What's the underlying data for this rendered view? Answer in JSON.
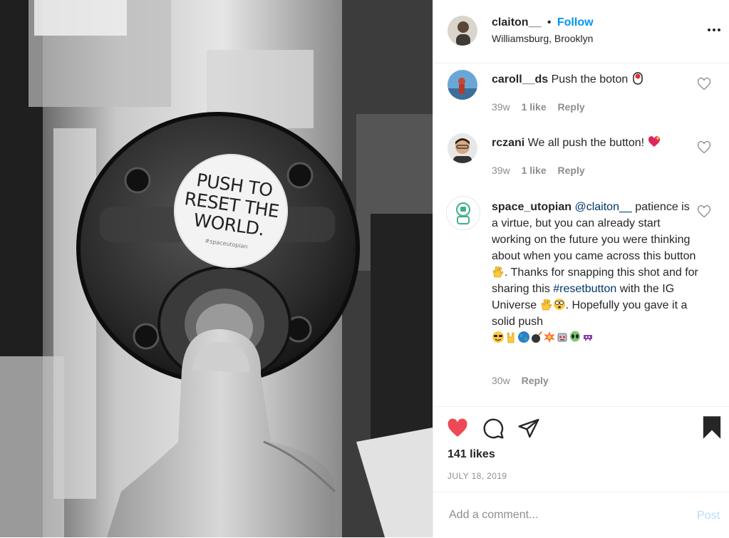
{
  "photo": {
    "sticker_lines": [
      "PUSH TO",
      "RESET THE",
      "WORLD."
    ],
    "sticker_tag": "#spaceutopian"
  },
  "header": {
    "username": "claiton__",
    "separator": "•",
    "follow_label": "Follow",
    "location": "Williamsburg, Brooklyn",
    "more_icon": "more-horizontal-icon"
  },
  "comments": [
    {
      "username": "caroll__ds",
      "text": "Push the boton",
      "emoji": [
        "pushpin-button-icon"
      ],
      "age": "39w",
      "likes": "1 like",
      "reply": "Reply"
    },
    {
      "username": "rczani",
      "text": "We all push the button!",
      "emoji": [
        "sparkling-heart-icon"
      ],
      "age": "39w",
      "likes": "1 like",
      "reply": "Reply"
    },
    {
      "username": "space_utopian",
      "mention": "@claiton__",
      "text_1": "patience is a virtue, but you can already start working on the future you were thinking about when you came across this button",
      "text_2": ". Thanks for snapping this shot and for sharing this",
      "hashtag": "#resetbutton",
      "text_3": "with the IG Universe",
      "text_4": ". Hopefully you gave it a solid push",
      "emoji": [
        "vulcan-salute-icon",
        "dizzy-face-icon",
        "sunglasses-face-icon",
        "rock-on-hand-icon",
        "globe-icon",
        "bomb-icon",
        "collision-icon",
        "robot-face-icon",
        "alien-icon",
        "space-invader-icon"
      ],
      "age": "30w",
      "reply": "Reply"
    }
  ],
  "actions": {
    "likes": "141 likes",
    "date": "JULY 18, 2019"
  },
  "add_comment": {
    "placeholder": "Add a comment...",
    "post_label": "Post"
  },
  "colors": {
    "accent": "#0095f6",
    "like_red": "#ed4956",
    "link_blue": "#00376b",
    "muted": "#8e8e8e",
    "post_disabled": "#b2dffc"
  }
}
